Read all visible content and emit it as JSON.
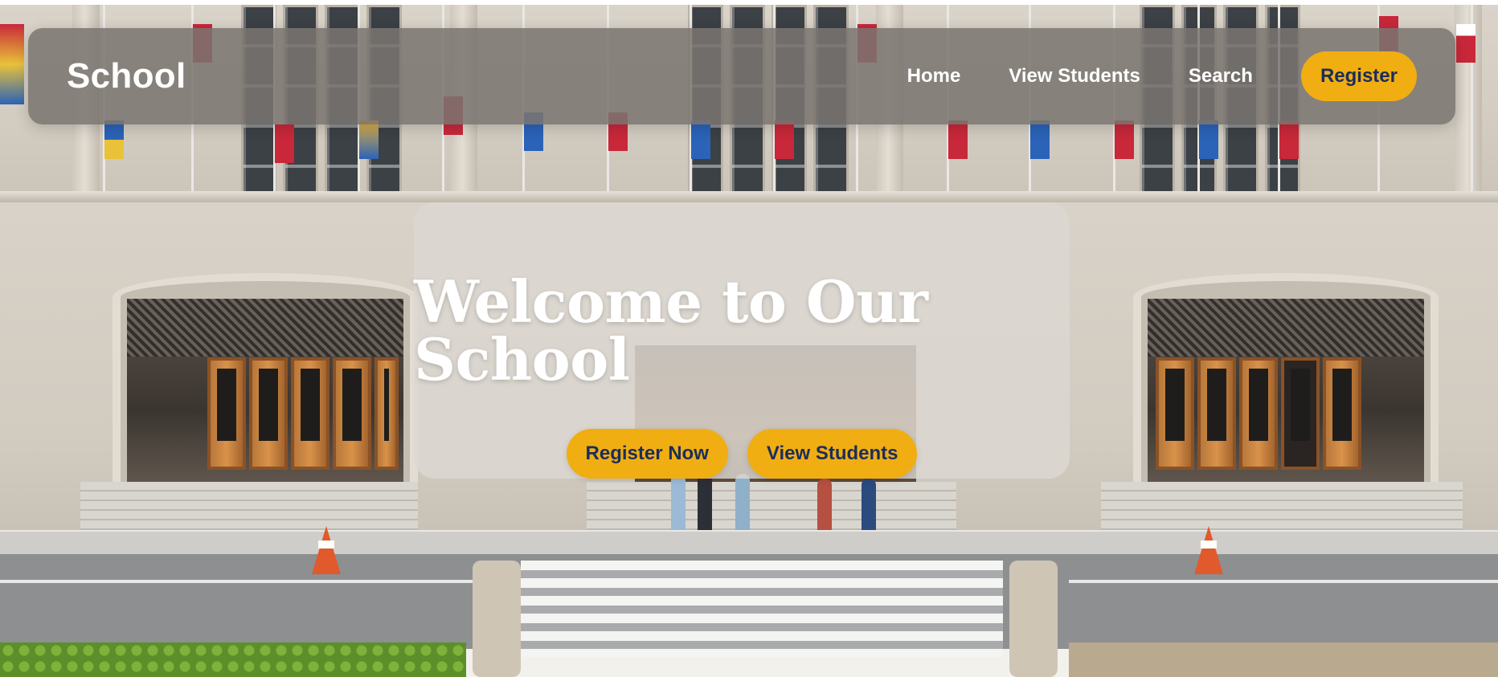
{
  "navbar": {
    "brand": "School",
    "links": [
      {
        "label": "Home"
      },
      {
        "label": "View Students"
      },
      {
        "label": "Search"
      }
    ],
    "register_label": "Register"
  },
  "hero": {
    "title": "Welcome to Our School",
    "primary_button": "Register Now",
    "secondary_button": "View Students"
  },
  "colors": {
    "accent": "#f0ae12",
    "button_text": "#1b2d5e",
    "nav_background": "#7a7570",
    "hero_card": "#dcd8d2"
  },
  "background": {
    "description_icon": "school-building-photo"
  }
}
